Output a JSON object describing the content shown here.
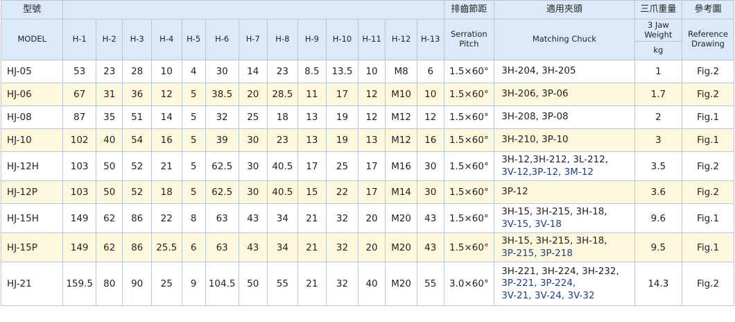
{
  "header": {
    "model_zh": "型號",
    "model_en": "MODEL",
    "h_cols": [
      "H-1",
      "H-2",
      "H-3",
      "H-4",
      "H-5",
      "H-6",
      "H-7",
      "H-8",
      "H-9",
      "H-10",
      "H-11",
      "H-12",
      "H-13"
    ],
    "serration_zh": "排齒節距",
    "serration_en": [
      "Serration",
      "Pitch"
    ],
    "chuck_zh": "適用夾頭",
    "chuck_en": "Matching Chuck",
    "weight_zh": "三爪重量",
    "weight_en": [
      "3 Jaw",
      "Weight"
    ],
    "weight_unit": "kg",
    "ref_zh": "參考圖",
    "ref_en": [
      "Reference",
      "Drawing"
    ]
  },
  "rows": [
    {
      "model": "HJ-05",
      "h": [
        "53",
        "23",
        "28",
        "10",
        "4",
        "30",
        "14",
        "23",
        "8.5",
        "13.5",
        "10",
        "M8",
        "6"
      ],
      "pitch": "1.5×60°",
      "chuck": [
        {
          "t": "3H-204, 3H-205",
          "blue": false
        }
      ],
      "weight": "1",
      "ref": "Fig.2"
    },
    {
      "model": "HJ-06",
      "h": [
        "67",
        "31",
        "36",
        "12",
        "5",
        "38.5",
        "20",
        "28.5",
        "11",
        "17",
        "12",
        "M10",
        "10"
      ],
      "pitch": "1.5×60°",
      "chuck": [
        {
          "t": "3H-206, 3P-06",
          "blue": false
        }
      ],
      "weight": "1.7",
      "ref": "Fig.2"
    },
    {
      "model": "HJ-08",
      "h": [
        "87",
        "35",
        "51",
        "14",
        "5",
        "32",
        "25",
        "18",
        "13",
        "19",
        "12",
        "M12",
        "12"
      ],
      "pitch": "1.5×60°",
      "chuck": [
        {
          "t": "3H-208, 3P-08",
          "blue": false
        }
      ],
      "weight": "2",
      "ref": "Fig.1"
    },
    {
      "model": "HJ-10",
      "h": [
        "102",
        "40",
        "54",
        "16",
        "5",
        "39",
        "30",
        "23",
        "13",
        "19",
        "13",
        "M12",
        "16"
      ],
      "pitch": "1.5×60°",
      "chuck": [
        {
          "t": "3H-210, 3P-10",
          "blue": false
        }
      ],
      "weight": "3",
      "ref": "Fig.1"
    },
    {
      "model": "HJ-12H",
      "h": [
        "103",
        "50",
        "52",
        "21",
        "5",
        "62.5",
        "30",
        "40.5",
        "17",
        "25",
        "17",
        "M16",
        "30"
      ],
      "pitch": "1.5×60°",
      "chuck": [
        {
          "t": "3H-12,3H-212, 3L-212,",
          "blue": false
        },
        {
          "t": "3V-12,3P-12, 3M-12",
          "blue": true
        }
      ],
      "weight": "3.5",
      "ref": "Fig.2"
    },
    {
      "model": "HJ-12P",
      "h": [
        "103",
        "50",
        "52",
        "18",
        "5",
        "62.5",
        "30",
        "40.5",
        "15",
        "22",
        "17",
        "M14",
        "30"
      ],
      "pitch": "1.5×60°",
      "chuck": [
        {
          "t": "3P-12",
          "blue": false
        }
      ],
      "weight": "3.6",
      "ref": "Fig.2"
    },
    {
      "model": "HJ-15H",
      "h": [
        "149",
        "62",
        "86",
        "22",
        "8",
        "63",
        "43",
        "34",
        "21",
        "32",
        "20",
        "M20",
        "43"
      ],
      "pitch": "1.5×60°",
      "chuck": [
        {
          "t": "3H-15, 3H-215, 3H-18,",
          "blue": false
        },
        {
          "t": "3V-15, 3V-18",
          "blue": true
        }
      ],
      "weight": "9.6",
      "ref": "Fig.1"
    },
    {
      "model": "HJ-15P",
      "h": [
        "149",
        "62",
        "86",
        "25.5",
        "6",
        "63",
        "43",
        "34",
        "21",
        "32",
        "20",
        "M20",
        "43"
      ],
      "pitch": "1.5×60°",
      "chuck": [
        {
          "t": "3H-15, 3H-215, 3H-18,",
          "blue": false
        },
        {
          "t": "3P-215, 3P-218",
          "blue": true
        }
      ],
      "weight": "9.5",
      "ref": "Fig.1"
    },
    {
      "model": "HJ-21",
      "h": [
        "159.5",
        "80",
        "90",
        "25",
        "9",
        "104.5",
        "50",
        "55",
        "21",
        "32",
        "40",
        "M20",
        "55"
      ],
      "pitch": "3.0×60°",
      "chuck": [
        {
          "t": "3H-221, 3H-224, 3H-232,",
          "blue": false
        },
        {
          "t": "3P-221, 3P-224,",
          "blue": true
        },
        {
          "t": "3V-21, 3V-24, 3V-32",
          "blue": true
        }
      ],
      "weight": "14.3",
      "ref": "Fig.2"
    }
  ]
}
